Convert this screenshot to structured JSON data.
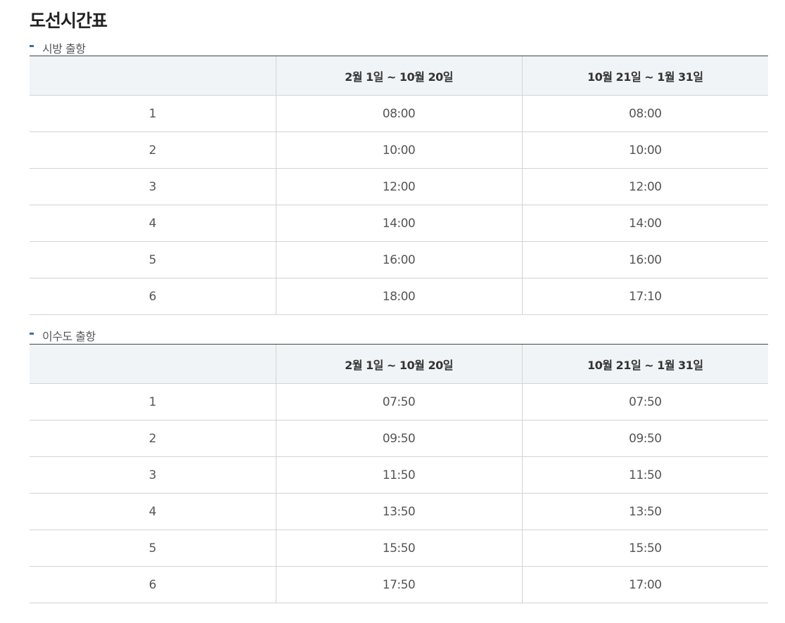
{
  "page": {
    "title": "도선시간표"
  },
  "sections": [
    {
      "label": "시방 출항",
      "columns": [
        "",
        "2월 1일 ~ 10월 20일",
        "10월 21일 ~ 1월 31일"
      ],
      "rows": [
        [
          "1",
          "08:00",
          "08:00"
        ],
        [
          "2",
          "10:00",
          "10:00"
        ],
        [
          "3",
          "12:00",
          "12:00"
        ],
        [
          "4",
          "14:00",
          "14:00"
        ],
        [
          "5",
          "16:00",
          "16:00"
        ],
        [
          "6",
          "18:00",
          "17:10"
        ]
      ]
    },
    {
      "label": "이수도 출항",
      "columns": [
        "",
        "2월 1일 ~ 10월 20일",
        "10월 21일 ~ 1월 31일"
      ],
      "rows": [
        [
          "1",
          "07:50",
          "07:50"
        ],
        [
          "2",
          "09:50",
          "09:50"
        ],
        [
          "3",
          "11:50",
          "11:50"
        ],
        [
          "4",
          "13:50",
          "13:50"
        ],
        [
          "5",
          "15:50",
          "15:50"
        ],
        [
          "6",
          "17:50",
          "17:00"
        ]
      ]
    }
  ],
  "colors": {
    "bullet": "#3a6ea8",
    "header_bg": "#f0f4f7",
    "border": "#d3d3d3",
    "top_border": "#444444"
  }
}
